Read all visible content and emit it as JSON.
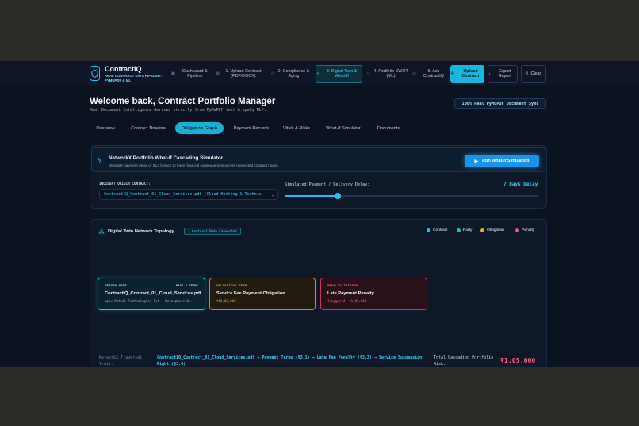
{
  "brand": {
    "name": "ContractIQ",
    "subtitle": "REAL CONTRACT DATA PIPELINE • PYMUPDF & ML"
  },
  "nav": [
    {
      "label": "Dashboard & Pipeline",
      "icon": "grid-icon"
    },
    {
      "label": "1. Upload Contract (PDF/DOCX)",
      "icon": "file-icon"
    },
    {
      "label": "2. Compliance & Aging",
      "icon": "shield-icon"
    },
    {
      "label": "3. Digital Twin & What-If",
      "icon": "network-icon",
      "active": true
    },
    {
      "label": "4. Portfolio SWOT (ML)",
      "icon": "target-icon"
    },
    {
      "label": "5. Ask ContractIQ",
      "icon": "chat-icon"
    }
  ],
  "actions": {
    "upload": "Upload Contract",
    "export": "Export Report",
    "clear": "Clear"
  },
  "header": {
    "title": "Welcome back, Contract Portfolio Manager",
    "subtitle": "Real Document Intelligence derived strictly from PyMuPDF text & spaCy NLP.",
    "sync_badge": "100% Real PyMuPDF Document Sync"
  },
  "tabs": [
    {
      "label": "Overview"
    },
    {
      "label": "Contract Timeline"
    },
    {
      "label": "Obligation Graph",
      "active": true
    },
    {
      "label": "Payment Records"
    },
    {
      "label": "Vitals & Risks"
    },
    {
      "label": "What-If Simulator"
    },
    {
      "label": "Documents"
    }
  ],
  "simulator": {
    "title": "NetworkX Portfolio What-If Cascading Simulator",
    "description": "Simulate payment delay or SLA breach to trace financial consequences across connected contract nodes.",
    "run_button": "Run What-If Simulation",
    "origin_label": "INCIDENT ORIGIN CONTRACT:",
    "origin_value": "ContractIQ_Contract_01_Cloud_Services.pdf (Cloud Hosting & Technic",
    "delay_label": "Simulated Payment / Delivery Delay:",
    "delay_value": "7 Days Delay",
    "delay_fraction": 0.21
  },
  "topology": {
    "title": "Digital Twin Network Topology",
    "badge": "1 Contract Node Connected",
    "legend": [
      {
        "label": "Contract",
        "color": "#22c3e6"
      },
      {
        "label": "Party",
        "color": "#22c58a"
      },
      {
        "label": "Obligation",
        "color": "#e8a62b"
      },
      {
        "label": "Penalty",
        "color": "#ee5a77"
      }
    ],
    "nodes": [
      {
        "type": "ORIGIN NODE",
        "page": "PAGE 5 TERMS",
        "title": "ContractIQ_Contract_01_Cloud_Services.pdf",
        "sub": "apex Retail Technologies Pvt ↔ Novasphere D..."
      },
      {
        "type": "OBLIGATION TERM",
        "title": "Service Fee Payment Obligation",
        "sub": "₹10,00,000"
      },
      {
        "type": "PENALTY TRIGGER",
        "title": "Late Payment Penalty",
        "sub": "Triggered: ₹1,05,000"
      }
    ]
  },
  "trail": {
    "label": "NetworkX Traversal Trail:",
    "text": "ContractIQ_Contract_01_Cloud_Services.pdf → Payment Terms (§3.1) → Late Fee Penalty (§3.3) → Service Suspension Right (§3.4)",
    "risk_label": "Total Cascading Portfolio Risk:",
    "risk_value": "₹1,05,000"
  }
}
